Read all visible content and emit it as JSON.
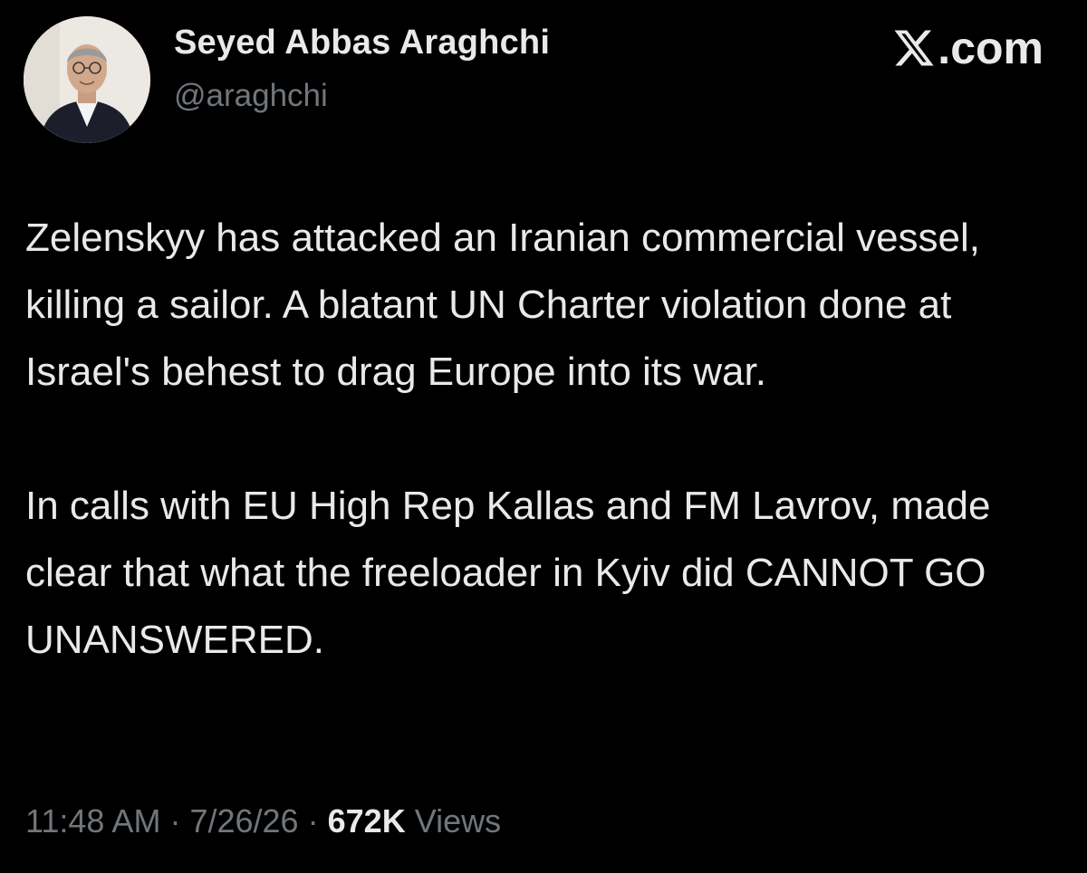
{
  "author": {
    "display_name": "Seyed Abbas Araghchi",
    "handle": "@araghchi"
  },
  "brand": {
    "label": ".com",
    "icon": "x-logo-icon"
  },
  "tweet": {
    "paragraphs": [
      "Zelenskyy has attacked an Iranian commercial vessel, killing a sailor. A blatant UN Charter violation done at Israel's behest to drag Europe into its war.",
      "In calls with EU High Rep Kallas and FM Lavrov, made clear that what the freeloader in Kyiv did CANNOT GO UNANSWERED."
    ]
  },
  "meta": {
    "time": "11:48 AM",
    "separator": "·",
    "date": "7/26/26",
    "views_count": "672K",
    "views_label": "Views"
  },
  "colors": {
    "background": "#000000",
    "primary_text": "#e7e9ea",
    "secondary_text": "#71767b"
  }
}
